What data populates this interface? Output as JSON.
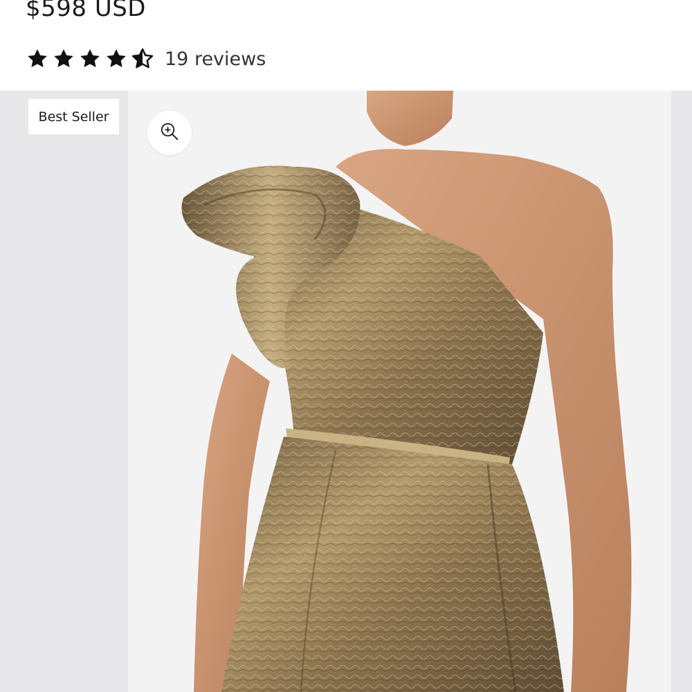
{
  "product": {
    "price": "$598 USD",
    "rating": 4.5,
    "rating_max": 5,
    "reviews_label": "19 reviews"
  },
  "gallery": {
    "badge": "Best Seller",
    "zoom_icon": "zoom-in-icon",
    "image_alt": "model wearing metallic gold one-shoulder ruffle dress"
  },
  "colors": {
    "star": "#111111",
    "gallery_bg": "#e7e7e9",
    "dress_gold": "#9c8257"
  }
}
